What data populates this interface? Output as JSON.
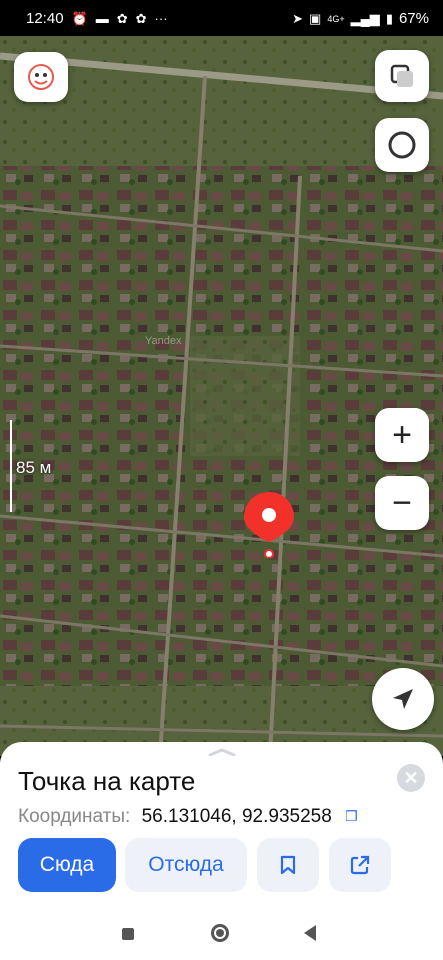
{
  "status_bar": {
    "time": "12:40",
    "battery": "67%",
    "network": "4G+"
  },
  "map": {
    "watermark": "Yandex",
    "scale_label": "85 м",
    "zoom_in_label": "+",
    "zoom_out_label": "−"
  },
  "sheet": {
    "title": "Точка на карте",
    "coords_label": "Координаты:",
    "coords_value": "56.131046, 92.935258",
    "close_label": "✕"
  },
  "actions": {
    "here": "Сюда",
    "from": "Отсюда"
  },
  "colors": {
    "accent": "#2a6ce8",
    "pin": "#f2312b",
    "secondary_button_bg": "#eef2f8"
  },
  "icons": [
    "alarm-icon",
    "gallery-icon",
    "flower-icon",
    "more-icon",
    "location-arrow-icon",
    "volte-icon",
    "signal-icon",
    "battery-icon",
    "layers-icon",
    "traffic-icon",
    "locate-icon",
    "bookmark-icon",
    "share-icon",
    "copy-icon",
    "close-icon"
  ]
}
